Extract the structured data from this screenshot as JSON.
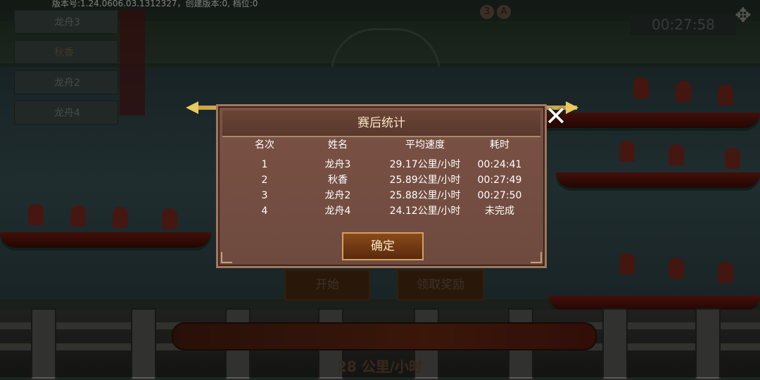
{
  "version_text": "版本号:1.24.0606.03.1312327，创建版本:0, 档位:0",
  "race_list": [
    {
      "name": "龙舟3"
    },
    {
      "name": "秋香"
    },
    {
      "name": "龙舟2"
    },
    {
      "name": "龙舟4"
    }
  ],
  "lap_badges": [
    "3",
    "A"
  ],
  "timer": "00:27:58",
  "buttons": {
    "start": "开始",
    "claim_reward": "领取奖励"
  },
  "speed_display": "28 公里/小时",
  "dialog": {
    "title": "赛后统计",
    "headers": {
      "rank": "名次",
      "name": "姓名",
      "avg_speed": "平均速度",
      "time": "耗时"
    },
    "rows": [
      {
        "rank": "1",
        "name": "龙舟3",
        "avg_speed": "29.17公里/小时",
        "time": "00:24:41"
      },
      {
        "rank": "2",
        "name": "秋香",
        "avg_speed": "25.89公里/小时",
        "time": "00:27:49"
      },
      {
        "rank": "3",
        "name": "龙舟2",
        "avg_speed": "25.88公里/小时",
        "time": "00:27:50"
      },
      {
        "rank": "4",
        "name": "龙舟4",
        "avg_speed": "24.12公里/小时",
        "time": "未完成"
      }
    ],
    "confirm_label": "确定"
  },
  "colors": {
    "dialog_bg": "#7b5245",
    "accent_gold": "#d4a060",
    "text": "#ffffff"
  }
}
